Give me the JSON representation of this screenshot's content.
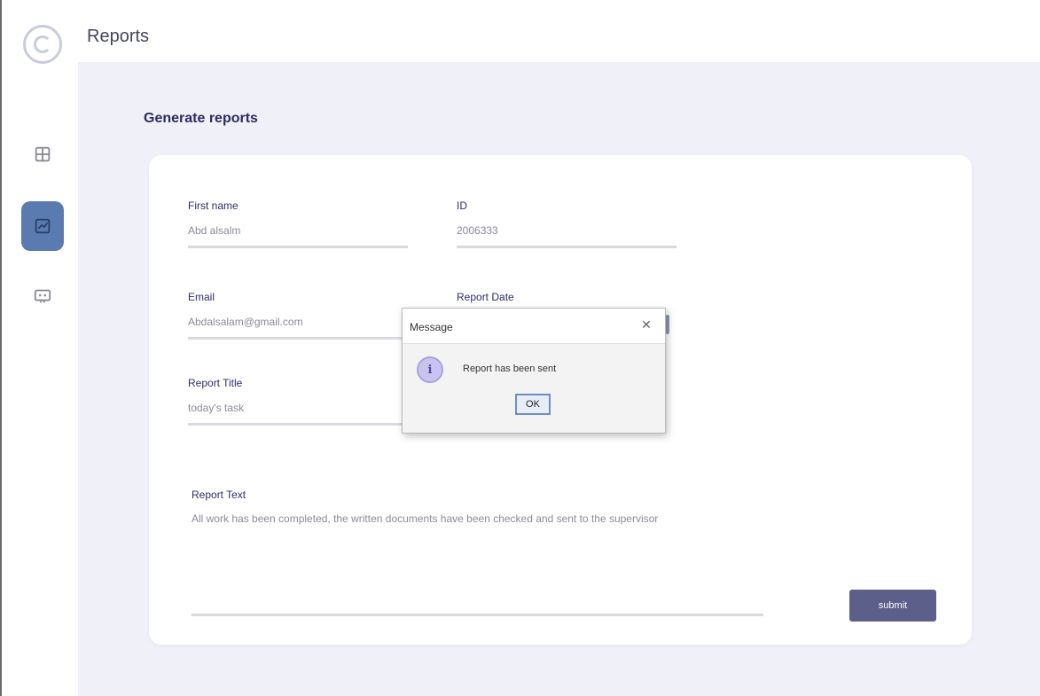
{
  "header": {
    "title": "Reports"
  },
  "sidebar": {
    "items": [
      {
        "icon": "dashboard-icon",
        "active": false
      },
      {
        "icon": "reports-icon",
        "active": true
      },
      {
        "icon": "chat-icon",
        "active": false
      }
    ]
  },
  "main": {
    "title": "Generate reports",
    "form": {
      "first_name": {
        "label": "First name",
        "value": "Abd alsalm"
      },
      "id": {
        "label": "ID",
        "value": "2006333"
      },
      "email": {
        "label": "Email",
        "value": "Abdalsalam@gmail.com"
      },
      "report_date": {
        "label": "Report Date",
        "value": ""
      },
      "report_title": {
        "label": "Report Title",
        "value": "today's task"
      },
      "report_text": {
        "label": "Report Text",
        "value": "All work has been completed, the written documents have been checked and sent to the supervisor"
      },
      "submit_label": "submit"
    }
  },
  "dialog": {
    "title": "Message",
    "close_glyph": "✕",
    "icon_glyph": "i",
    "message": "Report has been sent",
    "ok_label": "OK"
  },
  "colors": {
    "accent": "#5c5f8a",
    "sidebar_active": "#5a7bb0",
    "background": "#f0f1f8"
  }
}
